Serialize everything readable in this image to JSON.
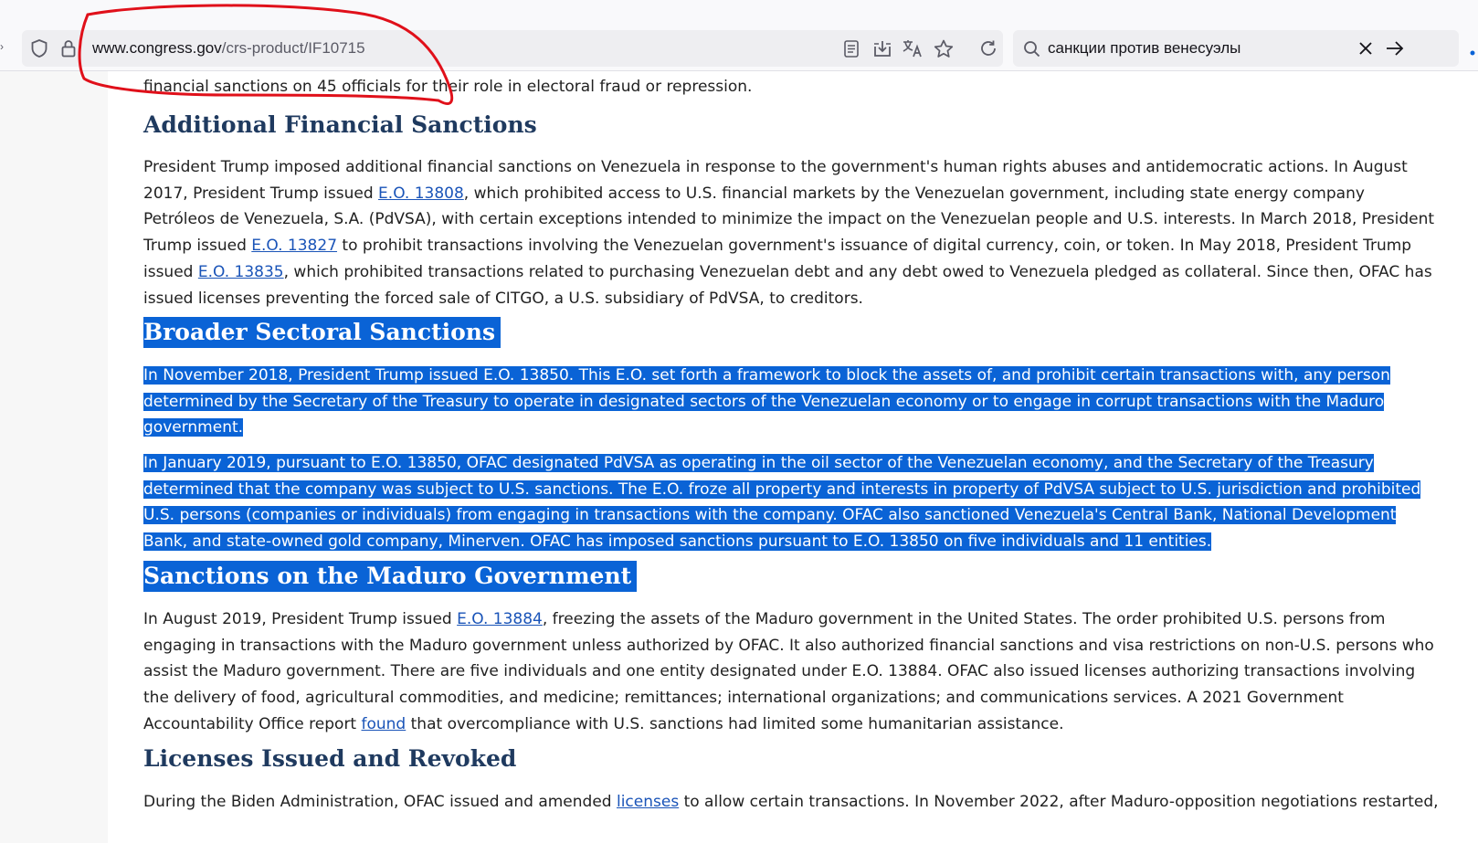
{
  "browser": {
    "url_domain": "www.congress.gov",
    "url_path": "/crs-product/IF10715",
    "search_query": "санкции против венесуэлы",
    "icons": [
      "shield-icon",
      "lock-icon",
      "reader-view-icon",
      "save-to-pocket-icon",
      "translate-icon",
      "bookmark-star-icon",
      "reload-icon",
      "search-icon",
      "clear-icon",
      "go-arrow-icon"
    ]
  },
  "article": {
    "top_fragment": "financial sanctions on 45 officials for their role in electoral fraud or repression.",
    "sections": [
      {
        "heading": "Additional Financial Sanctions",
        "paragraph": {
          "t1": "President Trump imposed additional financial sanctions on Venezuela in response to the government's human rights abuses and antidemocratic actions. In August 2017, President Trump issued ",
          "link1": "E.O. 13808",
          "t2": ", which prohibited access to U.S. financial markets by the Venezuelan government, including state energy company Petróleos de Venezuela, S.A. (PdVSA), with certain exceptions intended to minimize the impact on the Venezuelan people and U.S. interests. In March 2018, President Trump issued ",
          "link2": "E.O. 13827",
          "t3": " to prohibit transactions involving the Venezuelan government's issuance of digital currency, coin, or token. In May 2018, President Trump issued ",
          "link3": "E.O. 13835",
          "t4": ", which prohibited transactions related to purchasing Venezuelan debt and any debt owed to Venezuela pledged as collateral. Since then, OFAC has issued licenses preventing the forced sale of CITGO, a U.S. subsidiary of PdVSA, to creditors."
        }
      },
      {
        "heading": "Broader Sectoral Sanctions",
        "paragraph1": "In November 2018, President Trump issued E.O. 13850. This E.O. set forth a framework to block the assets of, and prohibit certain transactions with, any person determined by the Secretary of the Treasury to operate in designated sectors of the Venezuelan economy or to engage in corrupt transactions with the Maduro government.",
        "paragraph2": "In January 2019, pursuant to E.O. 13850, OFAC designated PdVSA as operating in the oil sector of the Venezuelan economy, and the Secretary of the Treasury determined that the company was subject to U.S. sanctions. The E.O. froze all property and interests in property of PdVSA subject to U.S. jurisdiction and prohibited U.S. persons (companies or individuals) from engaging in transactions with the company. OFAC also sanctioned Venezuela's Central Bank, National Development Bank, and state-owned gold company, Minerven. OFAC has imposed sanctions pursuant to E.O. 13850 on five individuals and 11 entities."
      },
      {
        "heading": "Sanctions on the Maduro Government",
        "paragraph": {
          "t1": "In August 2019, President Trump issued ",
          "link1": "E.O. 13884",
          "t2": ", freezing the assets of the Maduro government in the United States. The order prohibited U.S. persons from engaging in transactions with the Maduro government unless authorized by OFAC. It also authorized financial sanctions and visa restrictions on non-U.S. persons who assist the Maduro government. There are five individuals and one entity designated under E.O. 13884. OFAC also issued licenses authorizing transactions involving the delivery of food, agricultural commodities, and medicine; remittances; international organizations; and communications services. A 2021 Government Accountability Office report ",
          "link2": "found",
          "t3": " that overcompliance with U.S. sanctions had limited some humanitarian assistance."
        }
      },
      {
        "heading": "Licenses Issued and Revoked",
        "paragraph": {
          "t1": "During the Biden Administration, OFAC issued and amended ",
          "link1": "licenses",
          "t2": " to allow certain transactions. In November 2022, after Maduro-opposition negotiations restarted,"
        }
      }
    ]
  },
  "colors": {
    "selection": "#0a63d6",
    "heading": "#1f3a5f",
    "link": "#1a54b8",
    "annotation": "#e0101a"
  }
}
